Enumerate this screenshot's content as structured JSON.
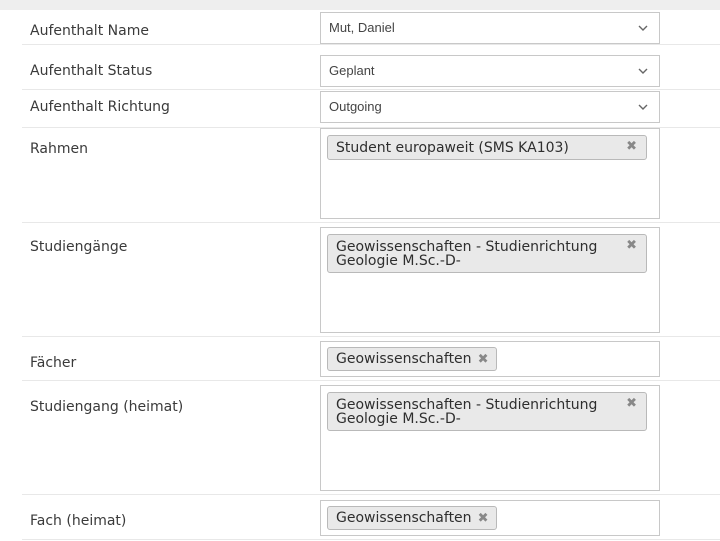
{
  "fields": {
    "aufenthalt_name": {
      "label": "Aufenthalt Name",
      "value": "Mut, Daniel"
    },
    "aufenthalt_status": {
      "label": "Aufenthalt Status",
      "value": "Geplant"
    },
    "aufenthalt_richtung": {
      "label": "Aufenthalt Richtung",
      "value": "Outgoing"
    },
    "rahmen": {
      "label": "Rahmen",
      "tags": [
        "Student europaweit (SMS KA103)"
      ]
    },
    "studiengaenge": {
      "label": "Studiengänge",
      "tags": [
        "Geowissenschaften - Studienrichtung Geologie M.Sc.-D-"
      ]
    },
    "faecher": {
      "label": "Fächer",
      "tags": [
        "Geowissenschaften"
      ]
    },
    "studiengang_heimat": {
      "label": "Studiengang (heimat)",
      "tags": [
        "Geowissenschaften - Studienrichtung Geologie M.Sc.-D-"
      ]
    },
    "fach_heimat": {
      "label": "Fach (heimat)",
      "tags": [
        "Geowissenschaften"
      ]
    }
  },
  "icons": {
    "dropdown": "chevron-down-icon",
    "remove": "close-icon",
    "remove_glyph": "✖"
  },
  "colors": {
    "chip_background": "#e9e9e9",
    "chip_border": "#b9b9b9",
    "field_border": "#c8c8c8",
    "row_divider": "#e8e8e8",
    "header_strip": "#eeeeee"
  }
}
